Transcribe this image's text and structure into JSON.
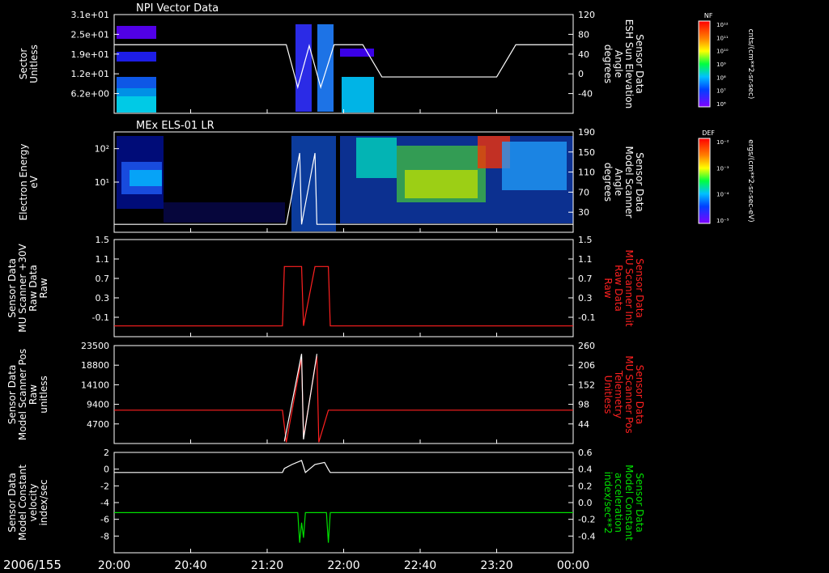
{
  "date_label": "2006/155",
  "x_ticks": [
    "20:00",
    "20:40",
    "21:20",
    "22:00",
    "22:40",
    "23:20",
    "00:00"
  ],
  "colors": {
    "white": "#ffffff",
    "red": "#ff2020",
    "green": "#00e000"
  },
  "panels": [
    {
      "title": "NPI Vector Data",
      "left_label": [
        "Sector",
        "Unitless"
      ],
      "left_ticks": [
        "3.1e+01",
        "2.5e+01",
        "1.9e+01",
        "1.2e+01",
        "6.2e+00"
      ],
      "right_label": [
        "Sensor Data",
        "ESH Sun Elevation",
        "Angle",
        "degrees"
      ],
      "right_ticks": [
        "120",
        "80",
        "40",
        "0",
        "-40"
      ],
      "colorbar": {
        "title": "NF",
        "units": "cnts/(cm**2-sr-sec)",
        "ticks": [
          "10¹²",
          "10¹¹",
          "10¹⁰",
          "10⁹",
          "10⁸",
          "10⁷",
          "10⁶"
        ]
      }
    },
    {
      "title": "MEx ELS-01 LR",
      "left_label": [
        "Electron Energy",
        "eV"
      ],
      "left_ticks": [
        "10²",
        "10¹"
      ],
      "right_label": [
        "Sensor Data",
        "Model Scanner",
        "Angle",
        "degrees"
      ],
      "right_ticks": [
        "190",
        "150",
        "110",
        "70",
        "30"
      ],
      "colorbar": {
        "title": "DEF",
        "units": "ergs/(cm**2-sr-sec-eV)",
        "ticks": [
          "10⁻²",
          "10⁻³",
          "10⁻⁴",
          "10⁻⁵"
        ]
      }
    },
    {
      "title": "",
      "left_label": [
        "Sensor Data",
        "MU Scanner +30V",
        "Raw Data",
        "Raw"
      ],
      "left_ticks": [
        "1.5",
        "1.1",
        "0.7",
        "0.3",
        "-0.1"
      ],
      "right_label": [
        "Sensor Data",
        "MU Scanner Init",
        "Raw Data",
        "Raw"
      ],
      "right_ticks": [
        "1.5",
        "1.1",
        "0.7",
        "0.3",
        "-0.1"
      ]
    },
    {
      "title": "",
      "left_label": [
        "Sensor Data",
        "Model Scanner Pos",
        "Raw",
        "unitless"
      ],
      "left_ticks": [
        "23500",
        "18800",
        "14100",
        "9400",
        "4700"
      ],
      "right_label": [
        "Sensor Data",
        "MU Scanner Pos",
        "Telemetry",
        "Unitless"
      ],
      "right_ticks": [
        "260",
        "206",
        "152",
        "98",
        "44"
      ]
    },
    {
      "title": "",
      "left_label": [
        "Sensor Data",
        "Model Constant",
        "velocity",
        "index/sec"
      ],
      "left_ticks": [
        "2",
        "0",
        "-2",
        "-4",
        "-6",
        "-8"
      ],
      "right_label": [
        "Sensor Data",
        "Model Constant",
        "acceleration",
        "index/sec**2"
      ],
      "right_ticks": [
        "0.6",
        "0.4",
        "0.2",
        "0.0",
        "-0.2",
        "-0.4"
      ]
    }
  ],
  "chart_data": [
    {
      "type": "heatmap",
      "title": "NPI Vector Data",
      "ylabel": "Sector Unitless",
      "y2label": "Sensor Data ESH Sun Elevation Angle degrees",
      "x_range": [
        "20:00",
        "00:00"
      ],
      "colorscale": "log",
      "overlay_line": {
        "name": "ESH Sun Elevation Angle",
        "x": [
          "20:00",
          "21:30",
          "21:36",
          "21:42",
          "21:48",
          "21:55",
          "22:10",
          "22:20",
          "23:10",
          "23:20",
          "23:30",
          "00:00"
        ],
        "y": [
          62,
          62,
          -20,
          60,
          -20,
          62,
          62,
          0,
          0,
          0,
          62,
          62
        ]
      }
    },
    {
      "type": "heatmap",
      "title": "MEx ELS-01 LR",
      "ylabel": "Electron Energy eV",
      "y2label": "Sensor Data Model Scanner Angle degrees",
      "x_range": [
        "20:00",
        "00:00"
      ],
      "colorscale": "log",
      "overlay_line": {
        "name": "Model Scanner Angle",
        "x": [
          "20:00",
          "21:28",
          "21:30",
          "21:37",
          "21:38",
          "21:45",
          "21:46",
          "21:52",
          "00:00"
        ],
        "y": [
          15,
          15,
          15,
          150,
          15,
          150,
          15,
          15,
          15
        ]
      }
    },
    {
      "type": "line",
      "x_range": [
        "20:00",
        "00:00"
      ],
      "ylim": [
        -0.3,
        1.5
      ],
      "series": [
        {
          "color": "red",
          "x": [
            "20:00",
            "21:28",
            "21:29",
            "21:38",
            "21:39",
            "21:45",
            "21:46",
            "21:52",
            "21:53",
            "00:00"
          ],
          "y": [
            -0.1,
            -0.1,
            1.0,
            1.0,
            -0.1,
            1.0,
            1.0,
            1.0,
            -0.1,
            -0.1
          ]
        }
      ]
    },
    {
      "type": "line",
      "x_range": [
        "20:00",
        "00:00"
      ],
      "ylim": [
        0,
        23500
      ],
      "series": [
        {
          "color": "red",
          "x": [
            "20:00",
            "21:28",
            "21:30",
            "21:38",
            "21:39",
            "21:46",
            "21:47",
            "21:52",
            "00:00"
          ],
          "y": [
            8000,
            8000,
            300,
            20500,
            1500,
            21000,
            300,
            8000,
            8000
          ]
        },
        {
          "color": "white",
          "x": [
            "21:29",
            "21:38",
            "21:39",
            "21:46"
          ],
          "y": [
            500,
            21500,
            1000,
            21500
          ]
        }
      ]
    },
    {
      "type": "line",
      "x_range": [
        "20:00",
        "00:00"
      ],
      "ylim": [
        -8,
        2
      ],
      "series": [
        {
          "color": "white",
          "x": [
            "20:00",
            "21:28",
            "21:29",
            "21:33",
            "21:38",
            "21:40",
            "21:45",
            "21:50",
            "21:52",
            "21:53",
            "00:00"
          ],
          "y": [
            0,
            0,
            0.4,
            0.8,
            1.2,
            0,
            0.8,
            1.0,
            0.3,
            0,
            0
          ]
        },
        {
          "color": "green",
          "x": [
            "20:00",
            "21:36",
            "21:37",
            "21:38",
            "21:39",
            "21:40",
            "21:51",
            "21:52",
            "21:53",
            "00:00"
          ],
          "y": [
            -4,
            -4,
            -7,
            -5,
            -6.5,
            -4,
            -4,
            -7,
            -4,
            -4
          ]
        }
      ]
    }
  ]
}
